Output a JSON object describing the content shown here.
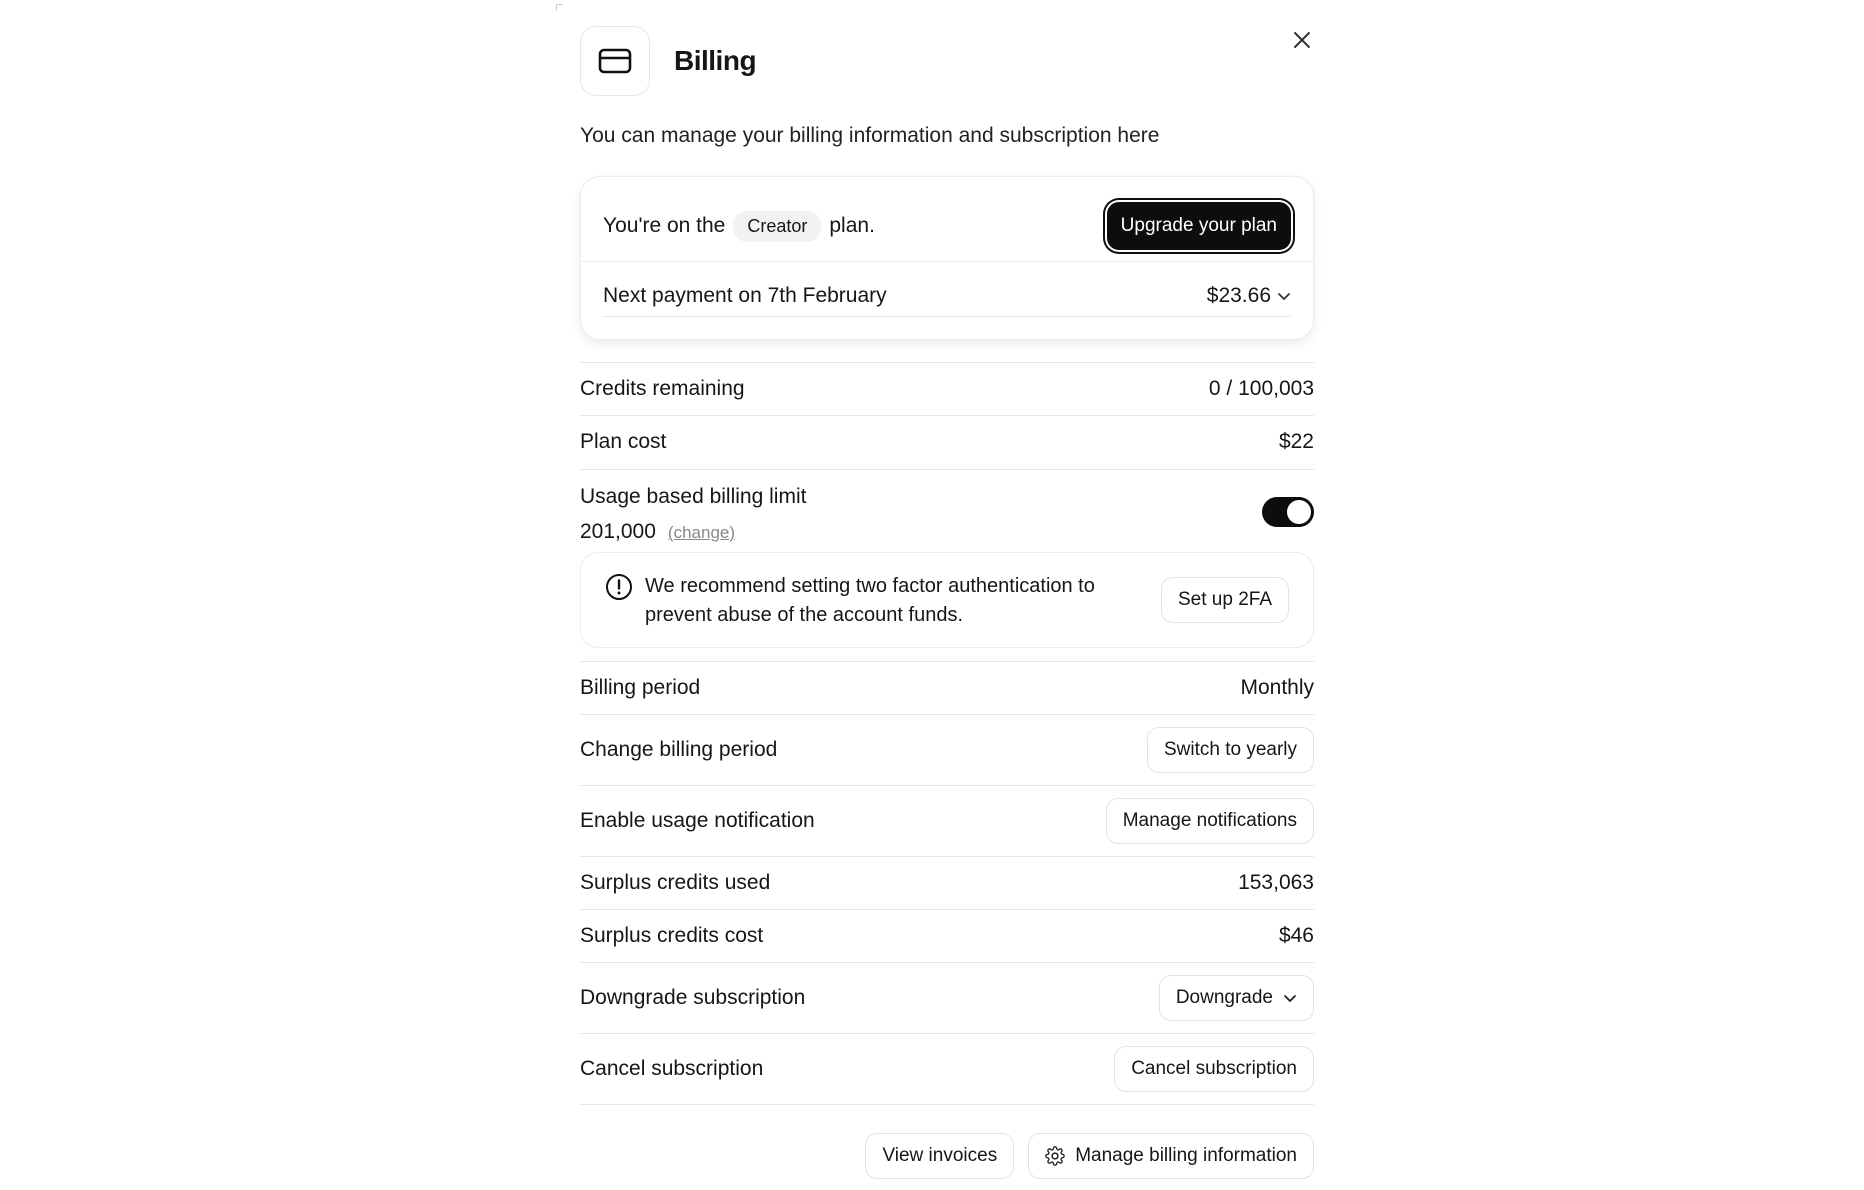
{
  "dialog": {
    "title": "Billing",
    "subtitle": "You can manage your billing information and subscription here"
  },
  "plan": {
    "prefix": "You're on the",
    "name": "Creator",
    "suffix": "plan.",
    "upgrade_label": "Upgrade your plan",
    "next_payment_label": "Next payment on 7th February",
    "next_payment_amount": "$23.66"
  },
  "credits": {
    "label": "Credits remaining",
    "value": "0 / 100,003"
  },
  "plan_cost": {
    "label": "Plan cost",
    "value": "$22"
  },
  "usage_limit": {
    "label": "Usage based billing limit",
    "value": "201,000",
    "change_label": "(change)",
    "enabled": true
  },
  "alert": {
    "text": "We recommend setting two factor authentication to prevent abuse of the account funds.",
    "button_label": "Set up 2FA"
  },
  "billing_period": {
    "label": "Billing period",
    "value": "Monthly"
  },
  "change_period": {
    "label": "Change billing period",
    "button_label": "Switch to yearly"
  },
  "notifications": {
    "label": "Enable usage notification",
    "button_label": "Manage notifications"
  },
  "surplus_used": {
    "label": "Surplus credits used",
    "value": "153,063"
  },
  "surplus_cost": {
    "label": "Surplus credits cost",
    "value": "$46"
  },
  "downgrade": {
    "label": "Downgrade subscription",
    "selected": "Downgrade"
  },
  "cancel": {
    "label": "Cancel subscription",
    "button_label": "Cancel subscription"
  },
  "footer": {
    "invoices_label": "View invoices",
    "manage_billing_label": "Manage billing information"
  },
  "icons": [
    "card-icon",
    "close-icon",
    "chevron-down-icon",
    "info-icon",
    "gear-icon"
  ],
  "colors": {
    "accent": "#0d0d0d",
    "border": "#e6e6e6",
    "muted": "#888888"
  }
}
